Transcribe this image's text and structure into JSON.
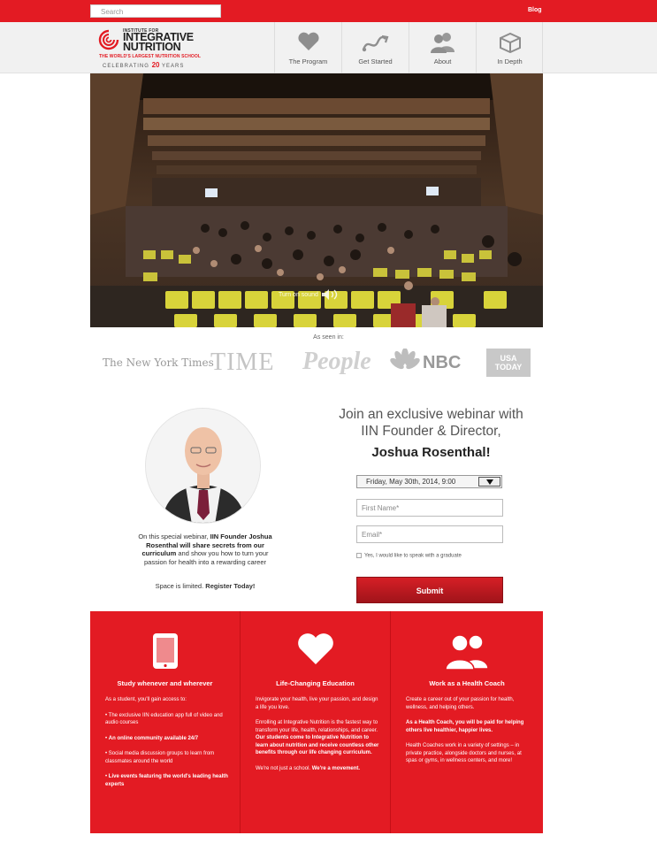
{
  "topbar": {
    "search_placeholder": "Search",
    "blog_link": "Blog"
  },
  "logo": {
    "line1": "INSTITUTE FOR",
    "line2": "INTEGRATIVE",
    "line3": "NUTRITION",
    "tagline": "THE WORLD'S LARGEST NUTRITION SCHOOL",
    "celebrating": "CELEBRATING",
    "years_num": "20",
    "years": "YEARS"
  },
  "nav": [
    {
      "label": "The Program",
      "icon": "heart-icon"
    },
    {
      "label": "Get Started",
      "icon": "path-arrow-icon"
    },
    {
      "label": "About",
      "icon": "people-icon"
    },
    {
      "label": "In Depth",
      "icon": "box-icon"
    }
  ],
  "hero": {
    "sound_label": "Turn on sound"
  },
  "press": {
    "label": "As seen in:",
    "logos": [
      "The New York Times",
      "TIME",
      "People",
      "NBC",
      "USA TODAY"
    ]
  },
  "host": {
    "bio_pre": "On this special webinar, ",
    "bio_bold": "IIN Founder Joshua Rosenthal will share secrets from our curriculum",
    "bio_post": " and show you how to turn your passion for health into a rewarding career",
    "space_pre": "Space is limited. ",
    "space_bold": "Register Today!"
  },
  "form": {
    "title_line1": "Join an exclusive webinar with",
    "title_line2": "IIN Founder & Director,",
    "title_name": "Joshua Rosenthal!",
    "date_value": "Friday, May 30th, 2014, 9:00",
    "first_name_placeholder": "First Name*",
    "email_placeholder": "Email*",
    "checkbox_label": "Yes, I would like to speak with a graduate",
    "submit_label": "Submit"
  },
  "features": [
    {
      "icon": "tablet-icon",
      "title": "Study whenever and wherever",
      "intro": "As a student, you'll gain access to:",
      "items": [
        {
          "text": "The exclusive IIN education app full of video and audio courses",
          "bold": false
        },
        {
          "text": "An online community available 24/7",
          "bold": true
        },
        {
          "text": "Social media discussion groups to learn from classmates around the world",
          "bold": false
        },
        {
          "text": "Live events featuring the world's leading health experts",
          "bold": true
        }
      ]
    },
    {
      "icon": "heart-icon",
      "title": "Life-Changing Education",
      "p1": "Invigorate your health, live your passion, and design a life you love.",
      "p2_pre": "Enrolling at Integrative Nutrition is the fastest way to transform your life, health, relationships, and career. ",
      "p2_bold": "Our students come to Integrative Nutrition to learn about nutrition and receive countless other benefits through our life changing curriculum.",
      "p3_pre": "We're not just a school. ",
      "p3_bold": "We're a movement."
    },
    {
      "icon": "coach-people-icon",
      "title": "Work as a Health Coach",
      "p1": "Create a career out of your passion for health, wellness, and helping others.",
      "p2_bold": "As a Health Coach, you will be paid for helping others live healthier, happier lives.",
      "p3": "Health Coaches work in a variety of settings – in private practice, alongside doctors and nurses, at spas or gyms, in wellness centers, and more!"
    }
  ],
  "colors": {
    "brand_red": "#e31b23",
    "dark_red": "#a0141a"
  }
}
